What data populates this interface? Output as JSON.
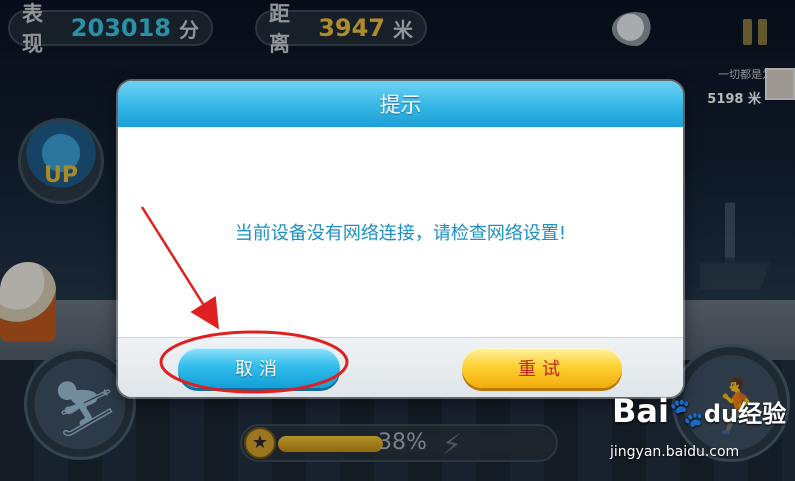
{
  "hud": {
    "score_label": "表现",
    "score_value": "203018",
    "score_unit": "分",
    "distance_label": "距离",
    "distance_value": "3947",
    "distance_unit": "米",
    "pause_icon": "pause-icon",
    "pet_icon": "pet-icon"
  },
  "rival": {
    "name": "一切都是为了爱",
    "distance": "5198 米"
  },
  "powerup": {
    "label": "UP"
  },
  "progress": {
    "value": 0.38,
    "label": "38%"
  },
  "dialog": {
    "title": "提示",
    "message": "当前设备没有网络连接，请检查网络设置!",
    "cancel_label": "取消",
    "retry_label": "重试"
  },
  "annotation": {
    "color": "#e02020"
  },
  "watermark": {
    "logo": "Bai",
    "logo_tail": "du",
    "logo_cn": "经验",
    "url": "jingyan.baidu.com"
  },
  "colors": {
    "dialog_header": "#35b6e6",
    "message_text": "#1c8fc4",
    "cancel_button": "#33bdec",
    "retry_button": "#ffd233",
    "retry_text": "#c0241a",
    "score_value": "#39c9e8",
    "distance_value": "#f2c23a"
  }
}
